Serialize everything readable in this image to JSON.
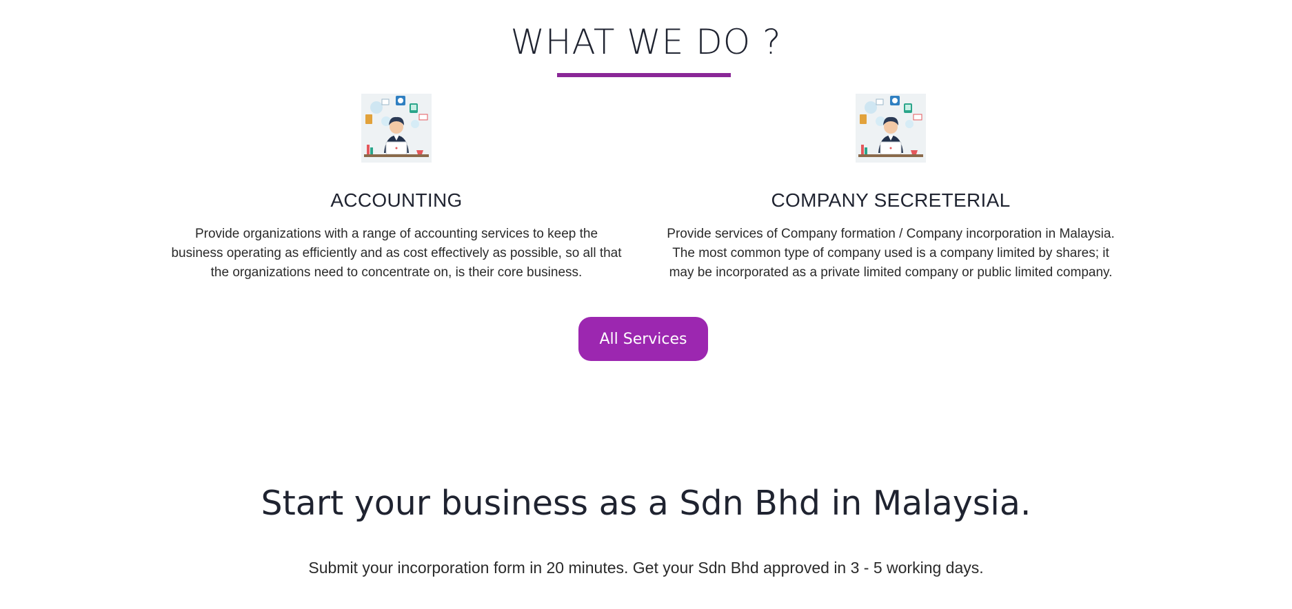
{
  "what_we_do": {
    "title": "WHAT WE DO ?",
    "accent_color": "#8a2797",
    "services": [
      {
        "heading": "ACCOUNTING",
        "description": "Provide organizations with a range of accounting services to keep the business operating as efficiently and as cost effectively as possible, so all that the organizations need to concentrate on, is their core business.",
        "illustration": "person-with-laptop-icon"
      },
      {
        "heading": "COMPANY SECRETERIAL",
        "description": "Provide services of Company formation / Company incorporation in Malaysia. The most common type of company used is a company limited by shares; it may be incorporated as a private limited company or public limited company.",
        "illustration": "person-with-laptop-icon"
      }
    ],
    "button_label": "All Services",
    "button_color": "#9c27b0"
  },
  "cta": {
    "heading": "Start your business as a Sdn Bhd in Malaysia.",
    "subtext": "Submit your incorporation form in 20 minutes. Get your Sdn Bhd approved in 3 - 5 working days."
  }
}
